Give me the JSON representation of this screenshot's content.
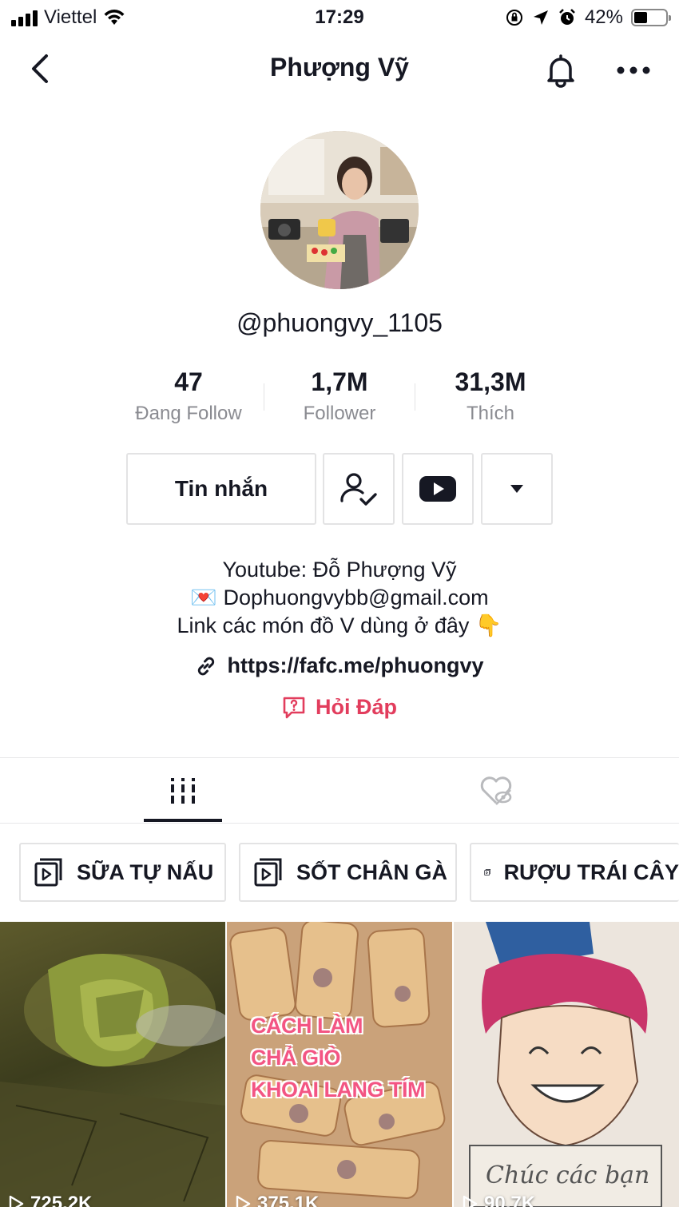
{
  "status_bar": {
    "carrier": "Viettel",
    "time": "17:29",
    "battery": "42%",
    "battery_level": 0.42
  },
  "nav": {
    "title": "Phượng Vỹ"
  },
  "profile": {
    "username": "@phuongvy_1105"
  },
  "stats": [
    {
      "value": "47",
      "label": "Đang Follow"
    },
    {
      "value": "1,7M",
      "label": "Follower"
    },
    {
      "value": "31,3M",
      "label": "Thích"
    }
  ],
  "actions": {
    "message_label": "Tin nhắn"
  },
  "bio": {
    "line1": "Youtube: Đỗ Phượng Vỹ",
    "line2": "💌 Dophuongvybb@gmail.com",
    "line3": "Link các món đồ V dùng ở đây 👇",
    "link": "https://fafc.me/phuongvy",
    "qa_label": "Hỏi Đáp"
  },
  "playlists": [
    {
      "label": "SỮA TỰ NẤU"
    },
    {
      "label": "SỐT CHÂN GÀ"
    },
    {
      "label": "RƯỢU TRÁI CÂY"
    }
  ],
  "videos": [
    {
      "views": "725,2K"
    },
    {
      "views": "375,1K",
      "overlay": [
        "CÁCH LÀM",
        "CHẢ GIÒ",
        "KHOAI LANG TÍM"
      ]
    },
    {
      "views": "90,7K",
      "drawn_text": "Chúc các bạn"
    }
  ],
  "colors": {
    "accent_red": "#e23d5d",
    "text_primary": "#161823",
    "text_secondary": "#8a8b91",
    "border": "#e3e3e4"
  }
}
